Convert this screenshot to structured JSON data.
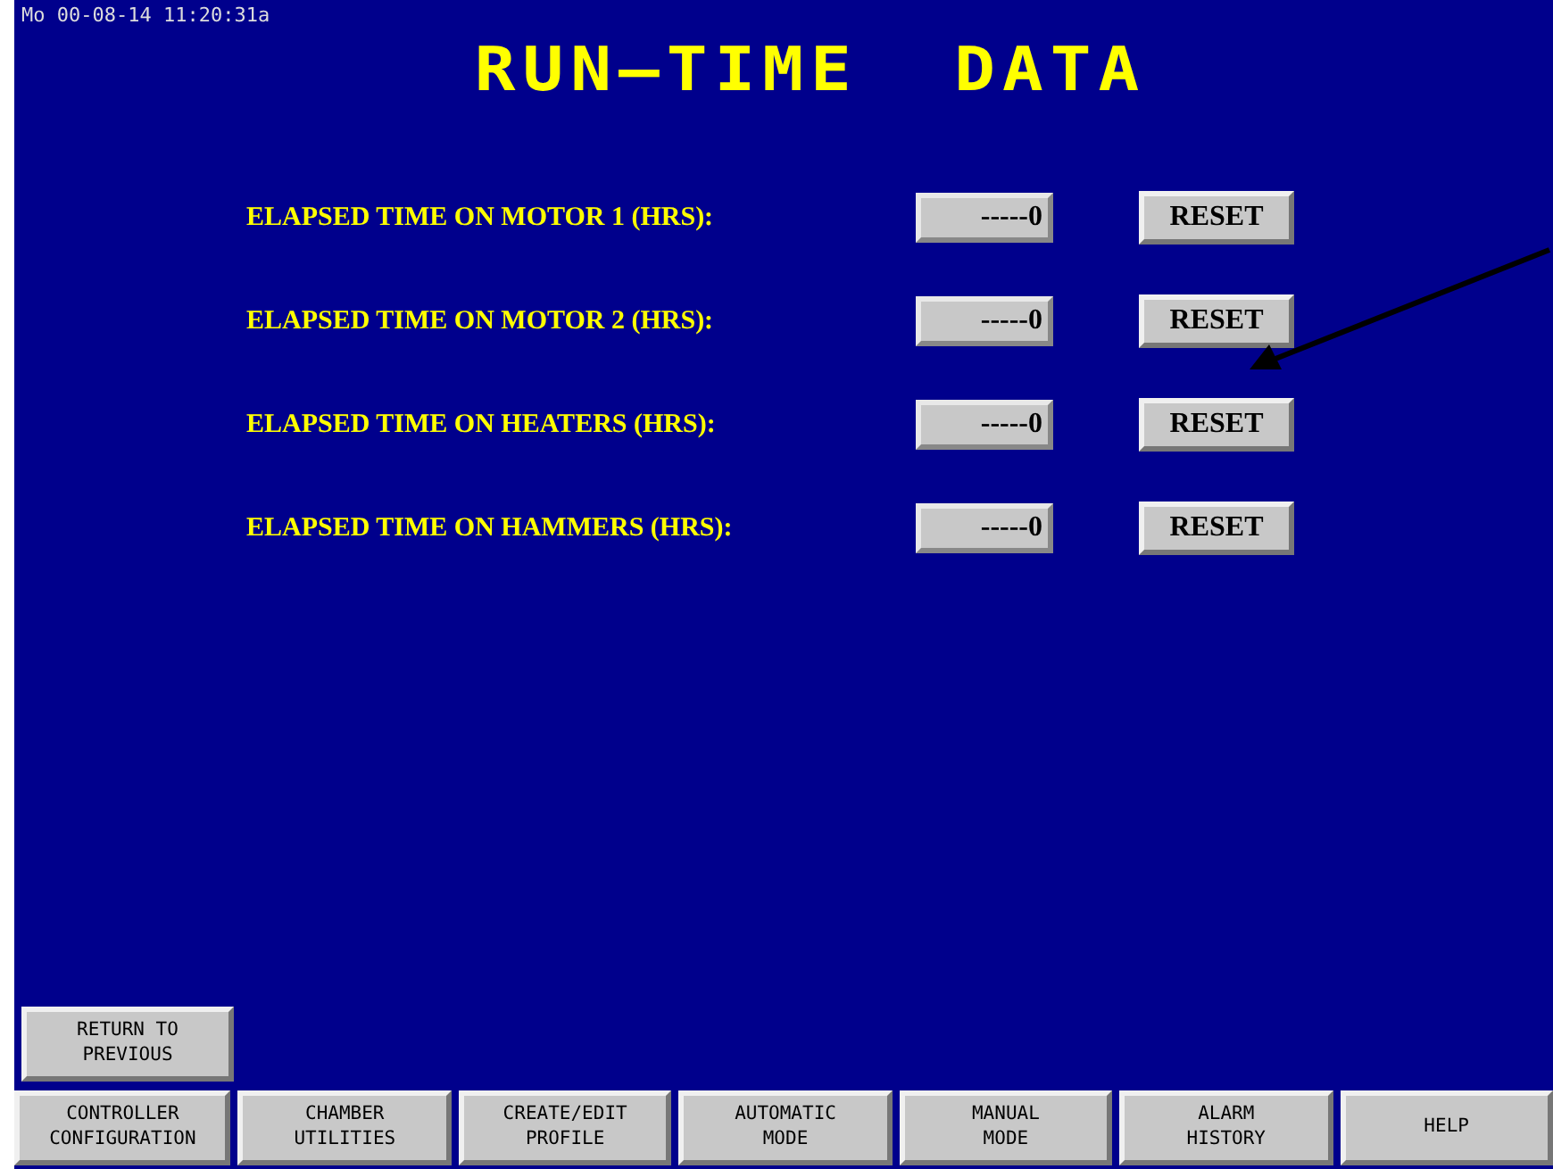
{
  "clock": "Mo 00-08-14 11:20:31a",
  "title": "RUN—TIME  DATA",
  "rows": [
    {
      "label": "ELAPSED TIME ON MOTOR 1 (HRS):",
      "value": "-----0",
      "button": "RESET"
    },
    {
      "label": "ELAPSED TIME ON MOTOR 2 (HRS):",
      "value": "-----0",
      "button": "RESET"
    },
    {
      "label": "ELAPSED TIME ON HEATERS (HRS):",
      "value": "-----0",
      "button": "RESET"
    },
    {
      "label": "ELAPSED TIME ON HAMMERS (HRS):",
      "value": "-----0",
      "button": "RESET"
    }
  ],
  "return_button": [
    "RETURN TO",
    "PREVIOUS"
  ],
  "nav": [
    [
      "CONTROLLER",
      "CONFIGURATION"
    ],
    [
      "CHAMBER",
      "UTILITIES"
    ],
    [
      "CREATE/EDIT",
      "PROFILE"
    ],
    [
      "AUTOMATIC",
      "MODE"
    ],
    [
      "MANUAL",
      "MODE"
    ],
    [
      "ALARM",
      "HISTORY"
    ],
    [
      "HELP"
    ]
  ]
}
